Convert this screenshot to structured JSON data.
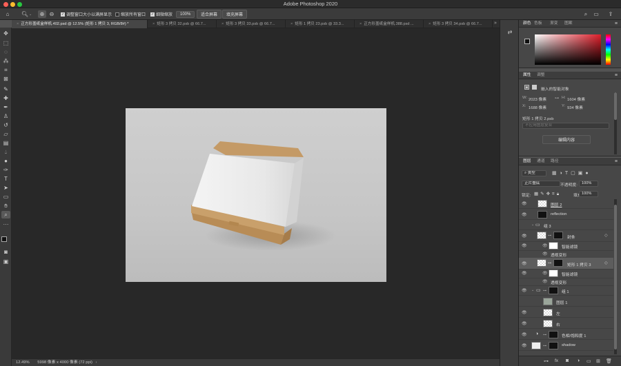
{
  "app": {
    "title": "Adobe Photoshop 2020",
    "traffic_lights": [
      "#ff5f57",
      "#febc2e",
      "#28c840"
    ]
  },
  "options_bar": {
    "resize_windows_label": "调整窗口大小以满屏显示",
    "zoom_all_windows_label": "缩放所有窗口",
    "scrubby_zoom_label": "细微缩放",
    "zoom_value": "100%",
    "fit_screen_label": "适合屏幕",
    "fill_screen_label": "填充屏幕"
  },
  "tabs": [
    {
      "label": "正方形盖纸盒样机.402.psd @ 12.5% (矩形 1 拷贝 3, RGB/8#) *",
      "active": true
    },
    {
      "label": "矩形 3 拷贝 32.psb @ 66.7..."
    },
    {
      "label": "矩形 3 拷贝 33.psb @ 66.7..."
    },
    {
      "label": "矩形 1 拷贝 23.psb @ 33.3..."
    },
    {
      "label": "正方形盖纸盒样机.388.psd ..."
    },
    {
      "label": "矩形 3 拷贝 34.psb @ 66.7..."
    }
  ],
  "status_bar": {
    "zoom": "12.49%",
    "doc_info": "5998 像素 x 4000 像素 (72 ppi)"
  },
  "color_panel": {
    "tabs": [
      "颜色",
      "色板",
      "渐变",
      "图案"
    ]
  },
  "properties_panel": {
    "tabs": [
      "属性",
      "调整"
    ],
    "object_type": "嵌入的智能对象",
    "w_label": "W:",
    "w_value": "2023 像素",
    "h_label": "H:",
    "h_value": "1604 像素",
    "x_label": "X:",
    "x_value": "1688 像素",
    "y_label": "Y:",
    "y_value": "934 像素",
    "file_name": "矩形 1 拷贝 2.psb",
    "layer_comp_placeholder": "不应用图层复合",
    "edit_contents_label": "编辑内容"
  },
  "layers_panel": {
    "tabs": [
      "图层",
      "通道",
      "路径"
    ],
    "filter_kind": "类型",
    "blend_mode": "正片叠底",
    "opacity_label": "不透明度:",
    "opacity_value": "100%",
    "lock_label": "锁定:",
    "fill_label": "填充:",
    "fill_value": "100%",
    "layers": [
      {
        "name": "图层 2",
        "visible": true
      },
      {
        "name": "reflection",
        "visible": true
      },
      {
        "name": "组 3",
        "visible": false
      },
      {
        "name": "封条",
        "visible": true
      },
      {
        "name": "智能滤镜",
        "visible": true
      },
      {
        "name": "透视变形",
        "visible": true
      },
      {
        "name": "矩形 1 拷贝 3",
        "visible": true,
        "selected": true
      },
      {
        "name": "智能滤镜",
        "visible": true
      },
      {
        "name": "透视变形",
        "visible": true
      },
      {
        "name": "组 1",
        "visible": true
      },
      {
        "name": "图层 1",
        "visible": false
      },
      {
        "name": "左",
        "visible": true
      },
      {
        "name": "右",
        "visible": true
      },
      {
        "name": "色相/饱和度 1",
        "visible": true
      },
      {
        "name": "shadow",
        "visible": true
      }
    ]
  }
}
